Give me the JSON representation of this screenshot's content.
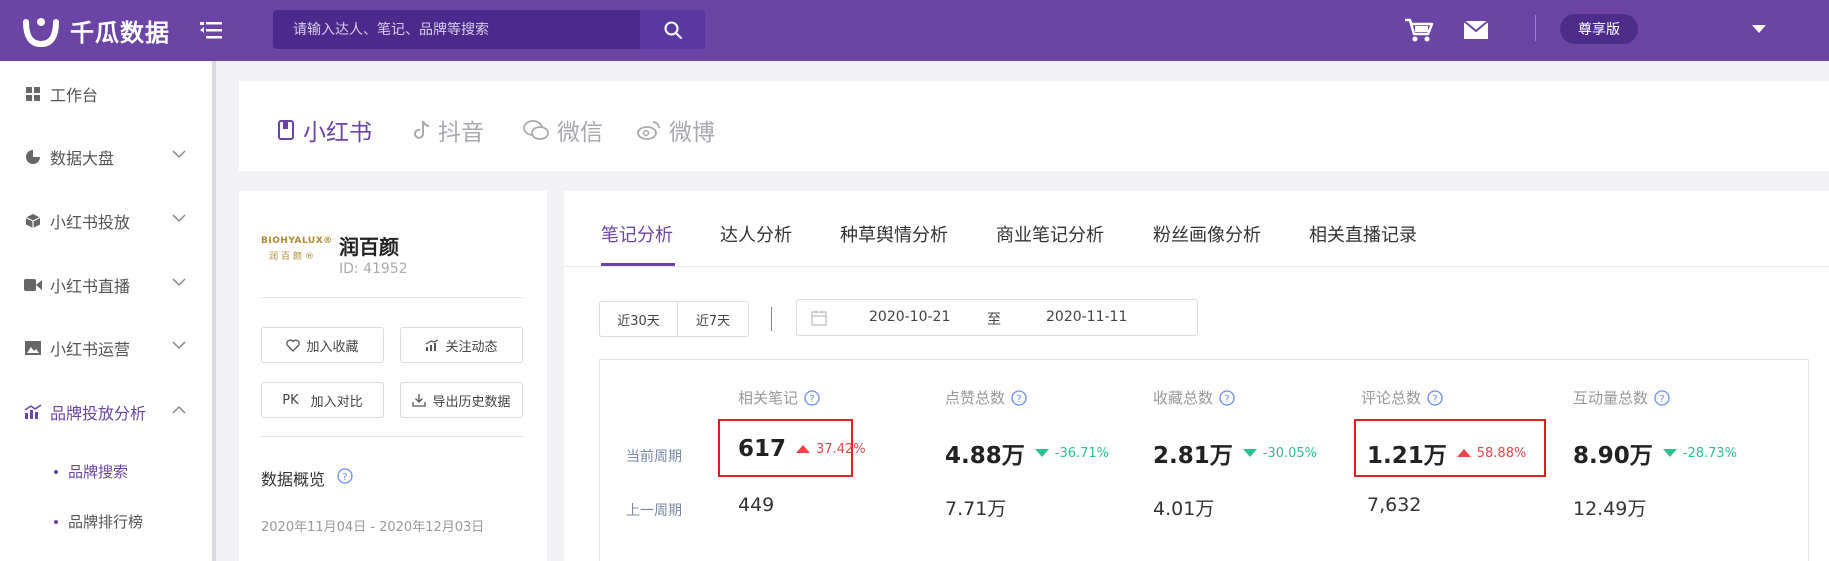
{
  "app": {
    "name": "千瓜数据"
  },
  "search": {
    "placeholder": "请输入达人、笔记、品牌等搜索"
  },
  "header": {
    "vip_label": "尊享版"
  },
  "sidebar": {
    "items": [
      {
        "label": "工作台",
        "icon": "grid-icon"
      },
      {
        "label": "数据大盘",
        "icon": "pie-chart-icon"
      },
      {
        "label": "小红书投放",
        "icon": "box-icon"
      },
      {
        "label": "小红书直播",
        "icon": "video-icon"
      },
      {
        "label": "小红书运营",
        "icon": "image-icon"
      },
      {
        "label": "品牌投放分析",
        "icon": "bar-chart-icon"
      }
    ],
    "sub_items": [
      {
        "label": "品牌搜索"
      },
      {
        "label": "品牌排行榜"
      }
    ]
  },
  "platform_tabs": [
    {
      "label": "小红书",
      "icon": "book-icon"
    },
    {
      "label": "抖音",
      "icon": "music-note-icon"
    },
    {
      "label": "微信",
      "icon": "wechat-icon"
    },
    {
      "label": "微博",
      "icon": "weibo-icon"
    }
  ],
  "brand": {
    "logo_line1": "BIOHYALUX®",
    "logo_line2": "润百颜®",
    "name": "润百颜",
    "id": "ID:  41952",
    "actions": {
      "favorite": "加入收藏",
      "follow": "关注动态",
      "compare_prefix": "PK",
      "compare": "加入对比",
      "export": "导出历史数据"
    },
    "overview_title": "数据概览",
    "overview_date": "2020年11月04日 - 2020年12月03日"
  },
  "analysis": {
    "tabs": [
      {
        "label": "笔记分析"
      },
      {
        "label": "达人分析"
      },
      {
        "label": "种草舆情分析"
      },
      {
        "label": "商业笔记分析"
      },
      {
        "label": "粉丝画像分析"
      },
      {
        "label": "相关直播记录"
      }
    ],
    "range_buttons": [
      "近30天",
      "近7天"
    ],
    "date_start": "2020-10-21",
    "date_to": "至",
    "date_end": "2020-11-11",
    "row_labels": {
      "current": "当前周期",
      "previous": "上一周期"
    },
    "columns": [
      {
        "label": "相关笔记",
        "current": "617",
        "trend": "up",
        "change": "37.42%",
        "previous": "449",
        "highlighted": true
      },
      {
        "label": "点赞总数",
        "current": "4.88万",
        "trend": "down",
        "change": "-36.71%",
        "previous": "7.71万",
        "highlighted": false
      },
      {
        "label": "收藏总数",
        "current": "2.81万",
        "trend": "down",
        "change": "-30.05%",
        "previous": "4.01万",
        "highlighted": false
      },
      {
        "label": "评论总数",
        "current": "1.21万",
        "trend": "up",
        "change": "58.88%",
        "previous": "7,632",
        "highlighted": true
      },
      {
        "label": "互动量总数",
        "current": "8.90万",
        "trend": "down",
        "change": "-28.73%",
        "previous": "12.49万",
        "highlighted": false
      }
    ]
  },
  "colors": {
    "brand_purple": "#6b44a6",
    "up_red": "#e8474a",
    "down_green": "#2dbf94",
    "highlight_red": "#e02020"
  }
}
